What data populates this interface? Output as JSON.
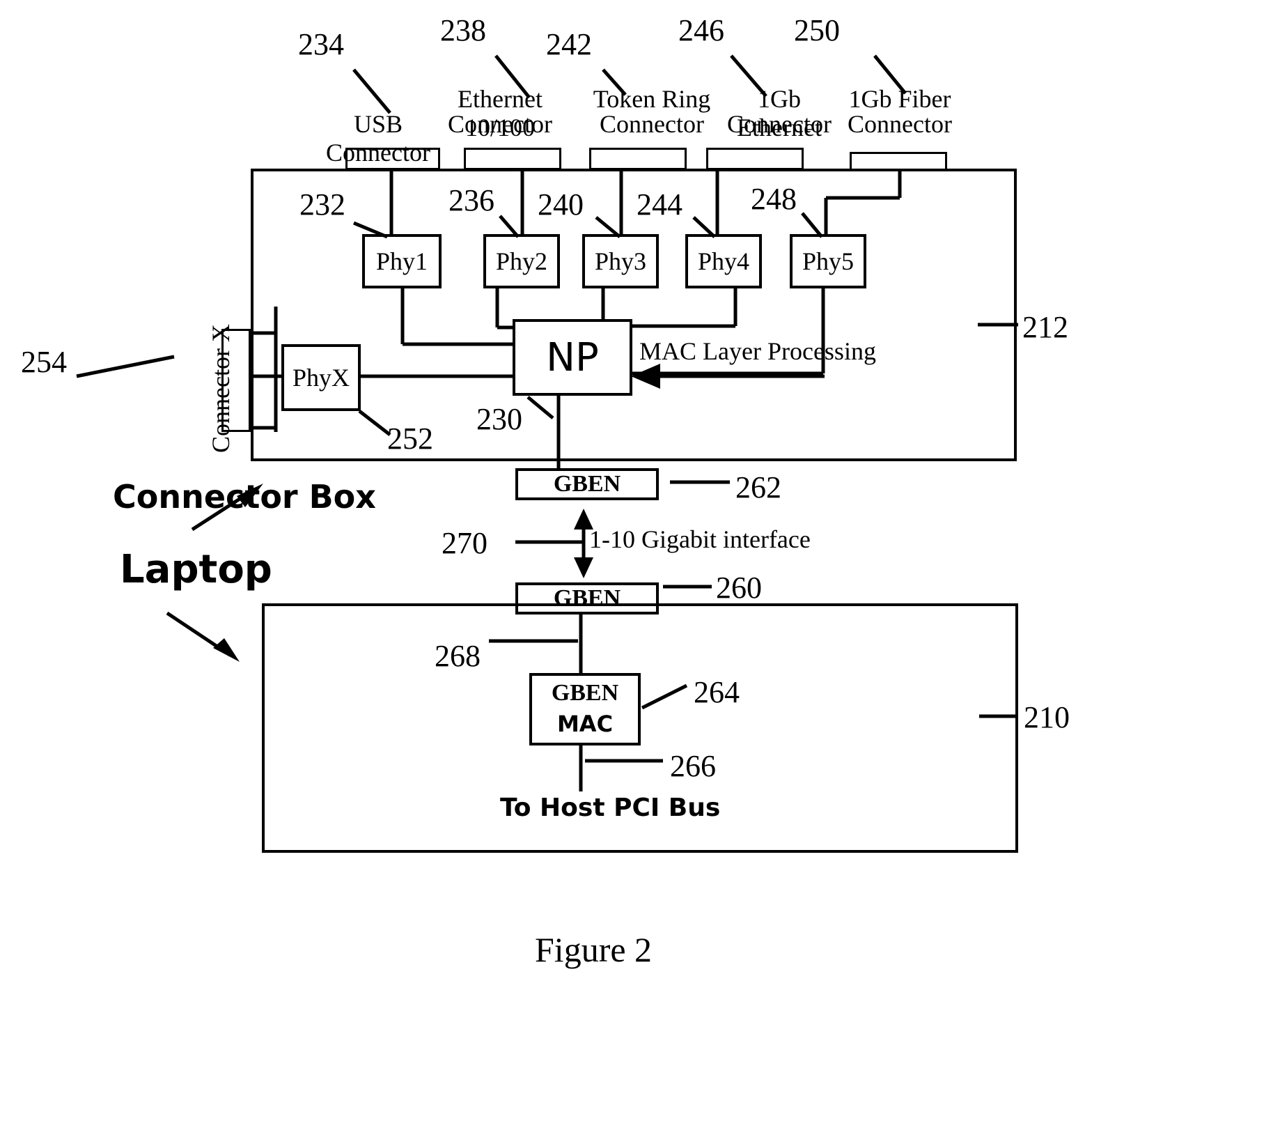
{
  "figure": {
    "caption": "Figure 2",
    "connector_box_label": "Connector Box",
    "laptop_label": "Laptop",
    "connector_x_label": "Connector X",
    "mac_layer_label": "MAC Layer Processing",
    "gigabit_interface_label": "1-10 Gigabit interface",
    "host_bus_label": "To Host PCI Bus"
  },
  "top_connectors": [
    {
      "ref": "234",
      "label": "USB Connector"
    },
    {
      "ref": "238",
      "label": "Ethernet 10/100 Connector"
    },
    {
      "ref": "242",
      "label": "Token Ring Connector"
    },
    {
      "ref": "246",
      "label": "1Gb Ethernet Connector"
    },
    {
      "ref": "250",
      "label": "1Gb Fiber Connector"
    }
  ],
  "top_connector_lines": [
    {
      "line1": "",
      "line2": "USB Connector"
    },
    {
      "line1": "Ethernet 10/100",
      "line2": "Connector"
    },
    {
      "line1": "Token Ring",
      "line2": "Connector"
    },
    {
      "line1": "1Gb Ethernet",
      "line2": "Connector"
    },
    {
      "line1": "1Gb Fiber",
      "line2": "Connector"
    }
  ],
  "phy_blocks": [
    {
      "ref": "232",
      "label": "Phy1"
    },
    {
      "ref": "236",
      "label": "Phy2"
    },
    {
      "ref": "240",
      "label": "Phy3"
    },
    {
      "ref": "244",
      "label": "Phy4"
    },
    {
      "ref": "248",
      "label": "Phy5"
    }
  ],
  "blocks": {
    "np": {
      "ref": "230",
      "label": "NP"
    },
    "phyx": {
      "ref": "252",
      "label": "PhyX"
    },
    "connector_box": {
      "ref": "212"
    },
    "connector_x": {
      "ref": "254"
    },
    "gben_top": {
      "ref": "262",
      "label": "GBEN"
    },
    "gben_bottom": {
      "ref": "260",
      "label": "GBEN"
    },
    "gben_mac": {
      "ref": "264",
      "label_line1": "GBEN",
      "label_line2": "MAC"
    },
    "laptop": {
      "ref": "210"
    },
    "interface_link": {
      "ref": "270"
    },
    "gben_mac_link": {
      "ref": "268"
    },
    "pci_bus_link": {
      "ref": "266"
    }
  }
}
